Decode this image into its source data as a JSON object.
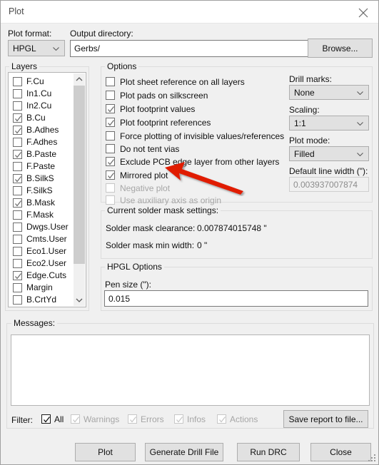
{
  "window": {
    "title": "Plot",
    "close_icon": "close-icon"
  },
  "top": {
    "plot_format_label": "Plot format:",
    "plot_format_value": "HPGL",
    "output_dir_label": "Output directory:",
    "output_dir_value": "Gerbs/",
    "browse_label": "Browse..."
  },
  "layers": {
    "group_title": "Layers",
    "items": [
      {
        "label": "F.Cu",
        "checked": false
      },
      {
        "label": "In1.Cu",
        "checked": false
      },
      {
        "label": "In2.Cu",
        "checked": false
      },
      {
        "label": "B.Cu",
        "checked": true
      },
      {
        "label": "B.Adhes",
        "checked": true
      },
      {
        "label": "F.Adhes",
        "checked": false
      },
      {
        "label": "B.Paste",
        "checked": true
      },
      {
        "label": "F.Paste",
        "checked": false
      },
      {
        "label": "B.SilkS",
        "checked": true
      },
      {
        "label": "F.SilkS",
        "checked": false
      },
      {
        "label": "B.Mask",
        "checked": true
      },
      {
        "label": "F.Mask",
        "checked": false
      },
      {
        "label": "Dwgs.User",
        "checked": false
      },
      {
        "label": "Cmts.User",
        "checked": false
      },
      {
        "label": "Eco1.User",
        "checked": false
      },
      {
        "label": "Eco2.User",
        "checked": false
      },
      {
        "label": "Edge.Cuts",
        "checked": true
      },
      {
        "label": "Margin",
        "checked": false
      },
      {
        "label": "B.CrtYd",
        "checked": false
      }
    ]
  },
  "options": {
    "group_title": "Options",
    "items": [
      {
        "label": "Plot sheet reference on all layers",
        "checked": false,
        "disabled": false
      },
      {
        "label": "Plot pads on silkscreen",
        "checked": false,
        "disabled": false
      },
      {
        "label": "Plot footprint values",
        "checked": true,
        "disabled": false
      },
      {
        "label": "Plot footprint references",
        "checked": true,
        "disabled": false
      },
      {
        "label": "Force plotting of invisible values/references",
        "checked": false,
        "disabled": false
      },
      {
        "label": "Do not tent vias",
        "checked": false,
        "disabled": false
      },
      {
        "label": "Exclude PCB edge layer from other layers",
        "checked": true,
        "disabled": false
      },
      {
        "label": "Mirrored plot",
        "checked": true,
        "disabled": false
      },
      {
        "label": "Negative plot",
        "checked": false,
        "disabled": true
      },
      {
        "label": "Use auxiliary axis as origin",
        "checked": false,
        "disabled": true
      }
    ]
  },
  "right_panel": {
    "drill_marks_label": "Drill marks:",
    "drill_marks_value": "None",
    "scaling_label": "Scaling:",
    "scaling_value": "1:1",
    "plot_mode_label": "Plot mode:",
    "plot_mode_value": "Filled",
    "default_line_width_label": "Default line width (\"):",
    "default_line_width_value": "0.003937007874"
  },
  "solder_mask": {
    "group_title": "Current solder mask settings:",
    "clearance_label": "Solder mask clearance:",
    "clearance_value": "0.007874015748 \"",
    "min_width_label": "Solder mask min width:",
    "min_width_value": "0 \""
  },
  "hpgl": {
    "group_title": "HPGL Options",
    "pen_size_label": "Pen size (\"):",
    "pen_size_value": "0.015"
  },
  "messages": {
    "group_title": "Messages:",
    "content": ""
  },
  "filter": {
    "label": "Filter:",
    "items": [
      {
        "label": "All",
        "checked": true,
        "disabled": false
      },
      {
        "label": "Warnings",
        "checked": true,
        "disabled": true
      },
      {
        "label": "Errors",
        "checked": true,
        "disabled": true
      },
      {
        "label": "Infos",
        "checked": true,
        "disabled": true
      },
      {
        "label": "Actions",
        "checked": true,
        "disabled": true
      }
    ],
    "save_report_label": "Save report to file..."
  },
  "footer": {
    "plot_label": "Plot",
    "generate_drill_label": "Generate Drill File",
    "run_drc_label": "Run DRC",
    "close_label": "Close"
  },
  "annotation": {
    "type": "arrow",
    "color": "#e01b00",
    "points_to": "Mirrored plot"
  }
}
